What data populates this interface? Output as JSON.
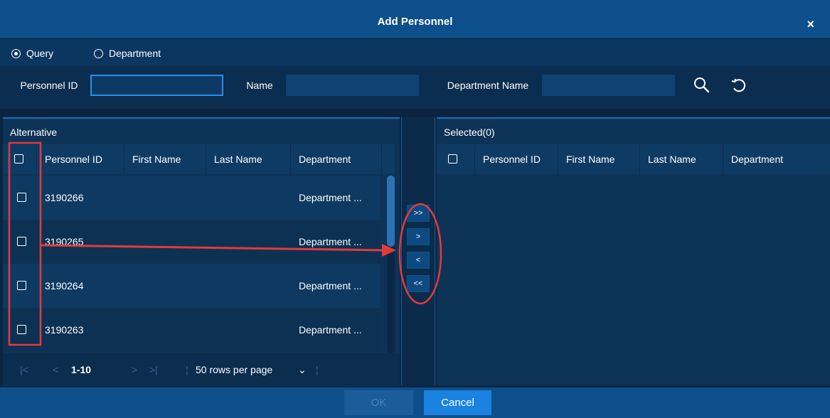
{
  "dialog": {
    "title": "Add Personnel",
    "close_label": "×"
  },
  "modes": {
    "query_label": "Query",
    "department_label": "Department",
    "selected": "Query"
  },
  "query": {
    "personnel_id_label": "Personnel ID",
    "personnel_id_value": "",
    "name_label": "Name",
    "name_value": "",
    "department_name_label": "Department Name",
    "department_name_value": ""
  },
  "alternative": {
    "title": "Alternative",
    "columns": [
      "Personnel ID",
      "First Name",
      "Last Name",
      "Department"
    ],
    "rows": [
      {
        "id": "3190266",
        "first": "",
        "last": "",
        "dept": "Department ..."
      },
      {
        "id": "3190265",
        "first": "",
        "last": "",
        "dept": "Department ..."
      },
      {
        "id": "3190264",
        "first": "",
        "last": "",
        "dept": "Department ..."
      },
      {
        "id": "3190263",
        "first": "",
        "last": "",
        "dept": "Department ..."
      }
    ],
    "pager": {
      "range": "1-10",
      "rows_per_page": "50 rows per page"
    }
  },
  "selected": {
    "title": "Selected(0)",
    "columns": [
      "Personnel ID",
      "First Name",
      "Last Name",
      "Department"
    ]
  },
  "transfer": {
    "add_all": ">>",
    "add": ">",
    "remove": "<",
    "remove_all": "<<"
  },
  "footer": {
    "ok_label": "OK",
    "cancel_label": "Cancel"
  },
  "colors": {
    "accent": "#1a82e0",
    "annotation": "#e53a3a"
  }
}
